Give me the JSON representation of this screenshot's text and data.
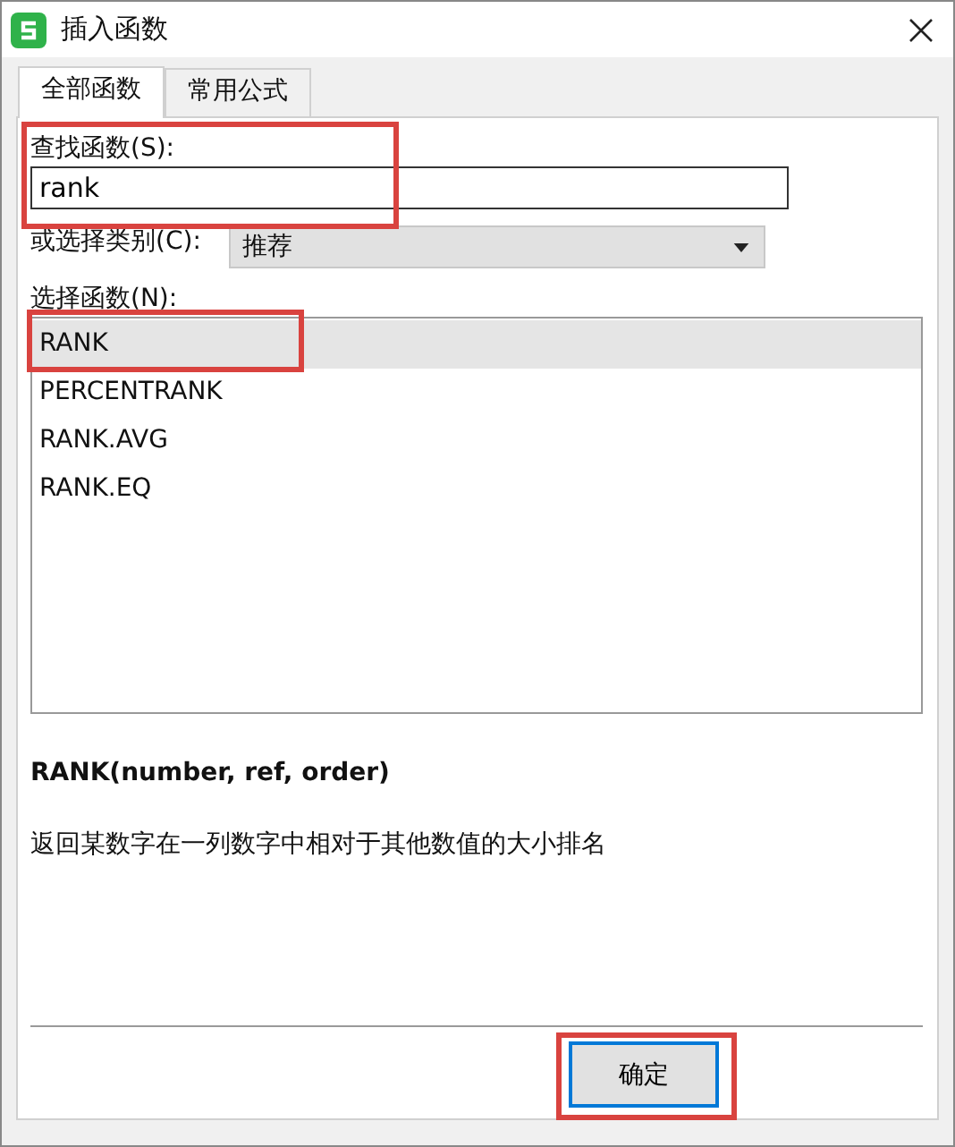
{
  "window": {
    "title": "插入函数"
  },
  "tabs": [
    {
      "label": "全部函数",
      "selected": true
    },
    {
      "label": "常用公式",
      "selected": false
    }
  ],
  "search": {
    "label": "查找函数(S):",
    "value": "rank",
    "highlighted": true
  },
  "category": {
    "label": "或选择类别(C):",
    "value": "推荐"
  },
  "function_list": {
    "label": "选择函数(N):",
    "items": [
      {
        "name": "RANK",
        "selected": true,
        "highlighted": true
      },
      {
        "name": "PERCENTRANK",
        "selected": false,
        "highlighted": false
      },
      {
        "name": "RANK.AVG",
        "selected": false,
        "highlighted": false
      },
      {
        "name": "RANK.EQ",
        "selected": false,
        "highlighted": false
      }
    ]
  },
  "signature": "RANK(number, ref, order)",
  "description": "返回某数字在一列数字中相对于其他数值的大小排名",
  "buttons": [
    {
      "label": "确定",
      "highlighted": true
    }
  ]
}
